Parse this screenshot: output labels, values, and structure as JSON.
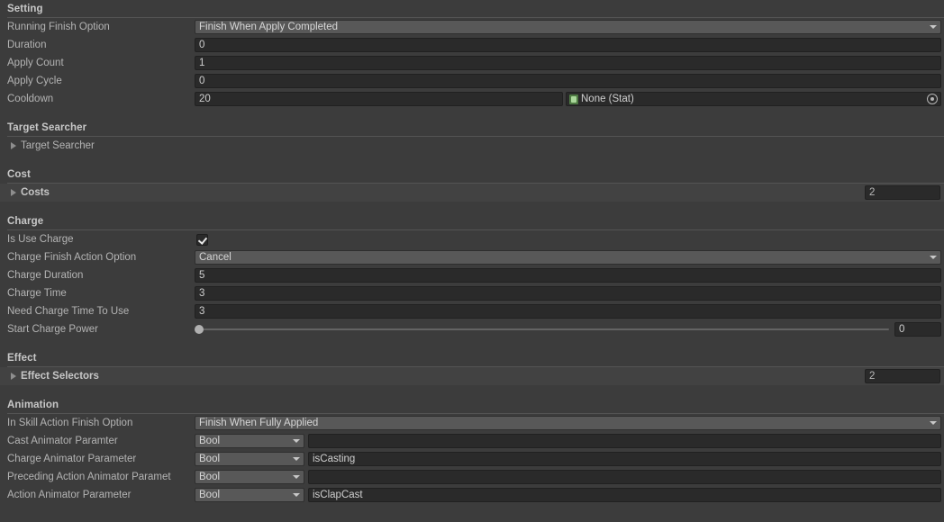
{
  "panel": {
    "type": "unity-inspector",
    "accent": "#3c3c3c",
    "field_bg": "#2a2a2a",
    "popup_bg": "#585858",
    "label_color": "#b4b4b4"
  },
  "sections": {
    "setting": {
      "title": "Setting",
      "rows": {
        "running_finish_option": {
          "label": "Running Finish Option",
          "value": "Finish When Apply Completed"
        },
        "duration": {
          "label": "Duration",
          "value": "0"
        },
        "apply_count": {
          "label": "Apply Count",
          "value": "1"
        },
        "apply_cycle": {
          "label": "Apply Cycle",
          "value": "0"
        },
        "cooldown": {
          "label": "Cooldown",
          "value": "20",
          "object_ref": "None (Stat)",
          "object_icon": "scriptable-object-icon",
          "picker_icon": "object-picker-icon"
        }
      }
    },
    "target_searcher": {
      "title": "Target Searcher",
      "foldout": {
        "label": "Target Searcher",
        "icon": "foldout-collapsed-icon"
      }
    },
    "cost": {
      "title": "Cost",
      "foldout": {
        "label": "Costs",
        "size": "2",
        "icon": "foldout-collapsed-icon"
      }
    },
    "charge": {
      "title": "Charge",
      "rows": {
        "is_use_charge": {
          "label": "Is Use Charge",
          "checked": true
        },
        "charge_finish_action_option": {
          "label": "Charge Finish Action Option",
          "value": "Cancel"
        },
        "charge_duration": {
          "label": "Charge Duration",
          "value": "5"
        },
        "charge_time": {
          "label": "Charge Time",
          "value": "3"
        },
        "need_charge_time_to_use": {
          "label": "Need Charge Time To Use",
          "value": "3"
        },
        "start_charge_power": {
          "label": "Start Charge Power",
          "value": "0",
          "slider_percent": 0
        }
      }
    },
    "effect": {
      "title": "Effect",
      "foldout": {
        "label": "Effect Selectors",
        "size": "2",
        "icon": "foldout-collapsed-icon"
      }
    },
    "animation": {
      "title": "Animation",
      "rows": {
        "in_skill_action_finish_option": {
          "label": "In Skill Action Finish Option",
          "value": "Finish When Fully Applied"
        },
        "cast_animator_parameter": {
          "label": "Cast Animator Paramter",
          "type": "Bool",
          "name": ""
        },
        "charge_animator_parameter": {
          "label": "Charge Animator Parameter",
          "type": "Bool",
          "name": "isCasting"
        },
        "preceding_action_animator_parameter": {
          "label": "Preceding Action Animator Paramet",
          "type": "Bool",
          "name": ""
        },
        "action_animator_parameter": {
          "label": "Action Animator Parameter",
          "type": "Bool",
          "name": "isClapCast"
        }
      }
    }
  }
}
